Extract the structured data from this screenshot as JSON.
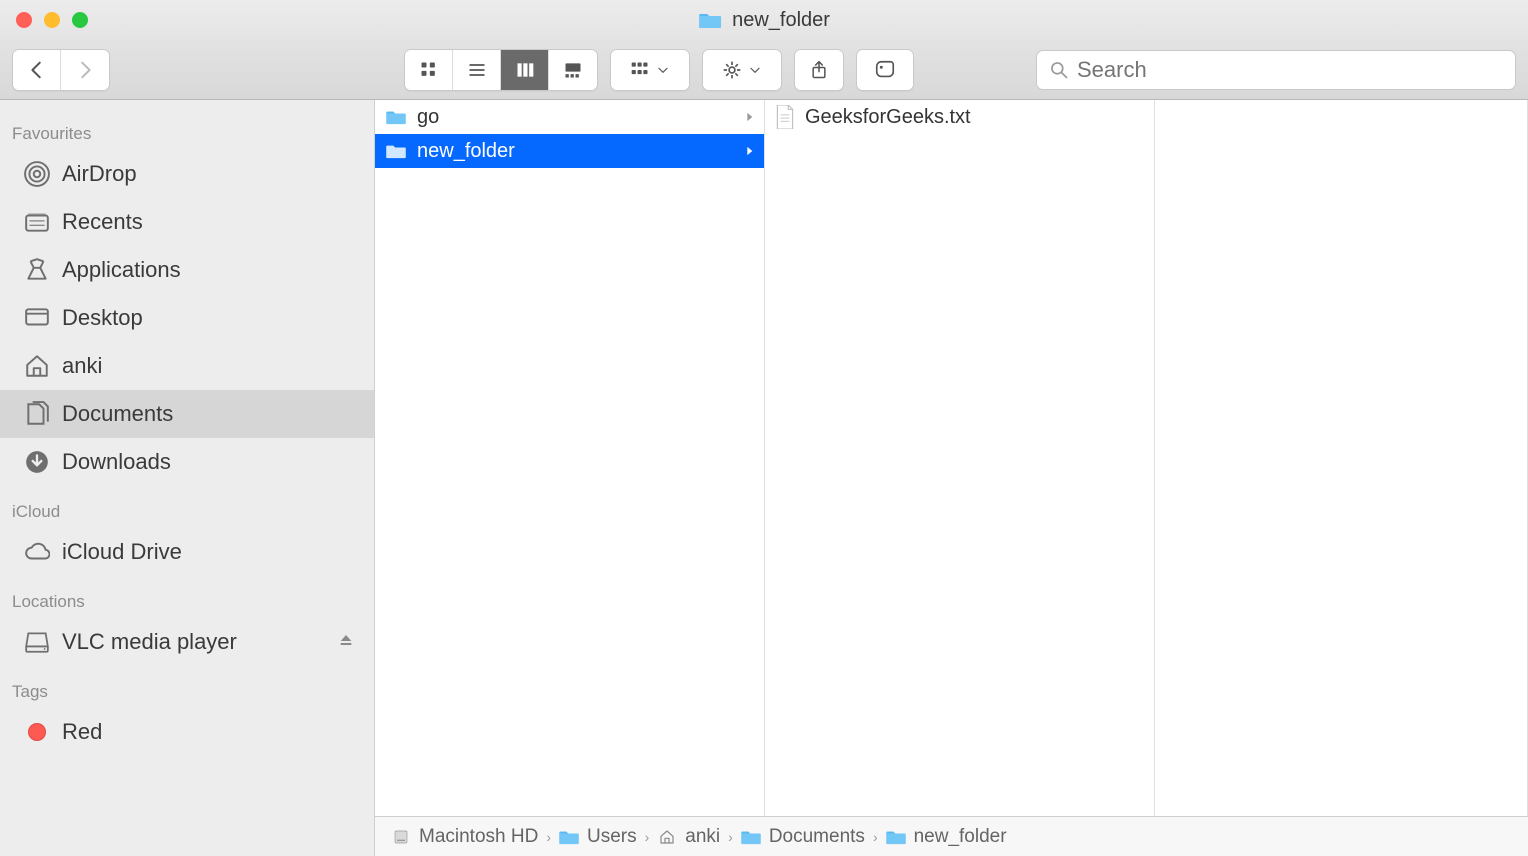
{
  "window": {
    "title": "new_folder"
  },
  "search": {
    "placeholder": "Search"
  },
  "sidebar": {
    "sections": [
      {
        "title": "Favourites",
        "items": [
          {
            "name": "AirDrop",
            "icon": "airdrop"
          },
          {
            "name": "Recents",
            "icon": "recents"
          },
          {
            "name": "Applications",
            "icon": "applications"
          },
          {
            "name": "Desktop",
            "icon": "desktop"
          },
          {
            "name": "anki",
            "icon": "home"
          },
          {
            "name": "Documents",
            "icon": "documents",
            "selected": true
          },
          {
            "name": "Downloads",
            "icon": "downloads"
          }
        ]
      },
      {
        "title": "iCloud",
        "items": [
          {
            "name": "iCloud Drive",
            "icon": "cloud"
          }
        ]
      },
      {
        "title": "Locations",
        "items": [
          {
            "name": "VLC media player",
            "icon": "drive",
            "eject": true
          }
        ]
      },
      {
        "title": "Tags",
        "items": [
          {
            "name": "Red",
            "icon": "tag",
            "color": "#ff5a52"
          }
        ]
      }
    ]
  },
  "columns": [
    {
      "items": [
        {
          "name": "go",
          "type": "folder"
        },
        {
          "name": "new_folder",
          "type": "folder",
          "selected": true
        }
      ]
    },
    {
      "items": [
        {
          "name": "GeeksforGeeks.txt",
          "type": "file"
        }
      ]
    },
    {
      "items": []
    }
  ],
  "pathbar": [
    {
      "name": "Macintosh HD",
      "icon": "hdd"
    },
    {
      "name": "Users",
      "icon": "folder"
    },
    {
      "name": "anki",
      "icon": "home"
    },
    {
      "name": "Documents",
      "icon": "folder"
    },
    {
      "name": "new_folder",
      "icon": "folder"
    }
  ]
}
